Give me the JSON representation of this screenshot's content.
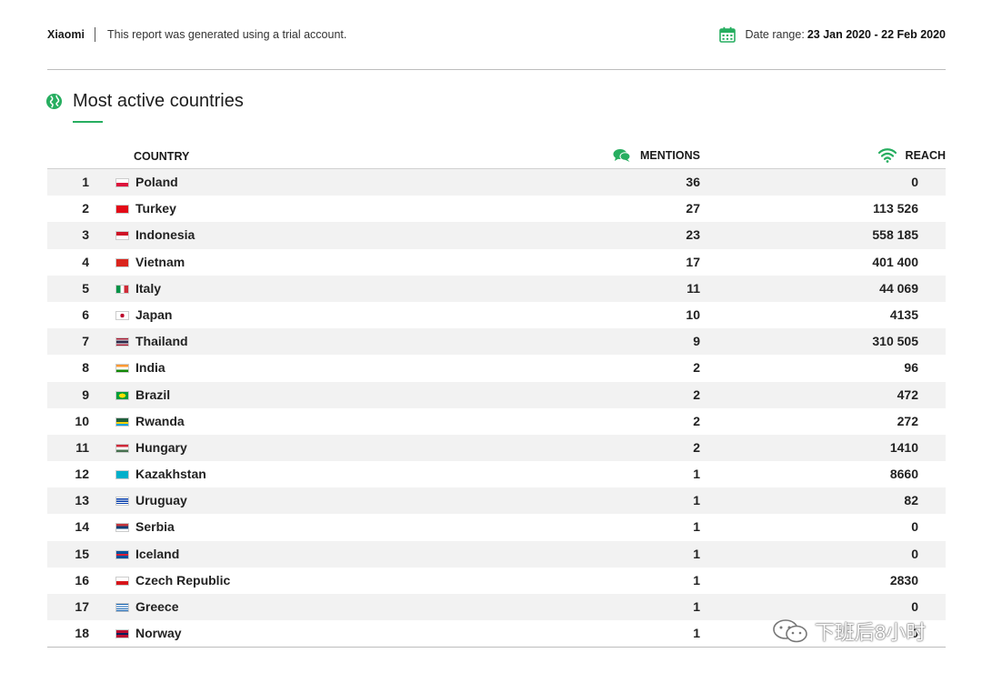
{
  "header": {
    "brand": "Xiaomi",
    "trial_notice": "This report was generated using a trial account.",
    "date_label": "Date range:",
    "date_value": "23 Jan 2020 - 22 Feb 2020",
    "accent_color": "#27ae60"
  },
  "section": {
    "title": "Most active countries",
    "icon": "globe-icon"
  },
  "table": {
    "columns": {
      "country": "COUNTRY",
      "mentions": "MENTIONS",
      "reach": "REACH"
    },
    "rows": [
      {
        "rank": "1",
        "country": "Poland",
        "mentions": "36",
        "reach": "0",
        "flag": "poland"
      },
      {
        "rank": "2",
        "country": "Turkey",
        "mentions": "27",
        "reach": "113 526",
        "flag": "turkey"
      },
      {
        "rank": "3",
        "country": "Indonesia",
        "mentions": "23",
        "reach": "558 185",
        "flag": "indonesia"
      },
      {
        "rank": "4",
        "country": "Vietnam",
        "mentions": "17",
        "reach": "401 400",
        "flag": "vietnam"
      },
      {
        "rank": "5",
        "country": "Italy",
        "mentions": "11",
        "reach": "44 069",
        "flag": "italy"
      },
      {
        "rank": "6",
        "country": "Japan",
        "mentions": "10",
        "reach": "4135",
        "flag": "japan"
      },
      {
        "rank": "7",
        "country": "Thailand",
        "mentions": "9",
        "reach": "310 505",
        "flag": "thailand"
      },
      {
        "rank": "8",
        "country": "India",
        "mentions": "2",
        "reach": "96",
        "flag": "india"
      },
      {
        "rank": "9",
        "country": "Brazil",
        "mentions": "2",
        "reach": "472",
        "flag": "brazil"
      },
      {
        "rank": "10",
        "country": "Rwanda",
        "mentions": "2",
        "reach": "272",
        "flag": "rwanda"
      },
      {
        "rank": "11",
        "country": "Hungary",
        "mentions": "2",
        "reach": "1410",
        "flag": "hungary"
      },
      {
        "rank": "12",
        "country": "Kazakhstan",
        "mentions": "1",
        "reach": "8660",
        "flag": "kazakhstan"
      },
      {
        "rank": "13",
        "country": "Uruguay",
        "mentions": "1",
        "reach": "82",
        "flag": "uruguay"
      },
      {
        "rank": "14",
        "country": "Serbia",
        "mentions": "1",
        "reach": "0",
        "flag": "serbia"
      },
      {
        "rank": "15",
        "country": "Iceland",
        "mentions": "1",
        "reach": "0",
        "flag": "iceland"
      },
      {
        "rank": "16",
        "country": "Czech Republic",
        "mentions": "1",
        "reach": "2830",
        "flag": "czech"
      },
      {
        "rank": "17",
        "country": "Greece",
        "mentions": "1",
        "reach": "0",
        "flag": "greece"
      },
      {
        "rank": "18",
        "country": "Norway",
        "mentions": "1",
        "reach": "0",
        "flag": "norway"
      }
    ]
  },
  "watermark": {
    "text": "下班后8小时",
    "icon": "wechat-icon"
  }
}
